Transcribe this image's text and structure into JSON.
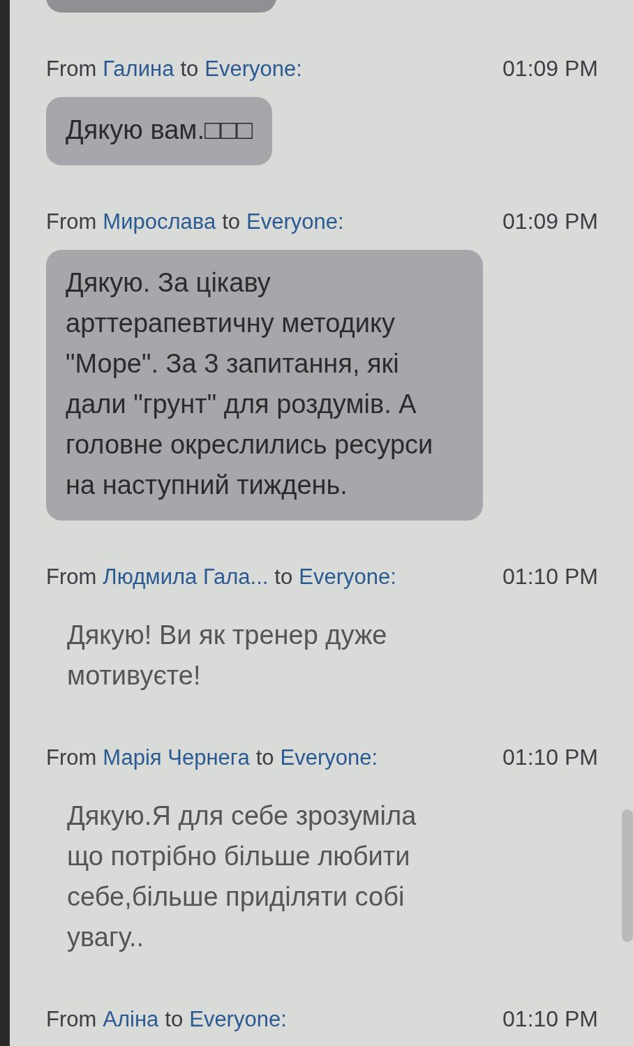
{
  "messages": [
    {
      "from_label": "From",
      "sender": "Галина",
      "to_label": "to",
      "recipient": "Everyone:",
      "time": "01:09 PM",
      "text": "Дякую вам.□□□",
      "bubble": true
    },
    {
      "from_label": "From",
      "sender": "Мирослава",
      "to_label": "to",
      "recipient": "Everyone:",
      "time": "01:09 PM",
      "text": "Дякую. За цікаву арттерапевтичну методику \"Море\". За 3 запитання, які дали \"грунт\" для роздумів. А головне окреслились ресурси на наступний тиждень.",
      "bubble": true
    },
    {
      "from_label": "From",
      "sender": "Людмила Гала...",
      "to_label": "to",
      "recipient": "Everyone:",
      "time": "01:10 PM",
      "text": "Дякую! Ви як тренер дуже мотивуєте!",
      "bubble": false
    },
    {
      "from_label": "From",
      "sender": "Марія Чернега",
      "to_label": "to",
      "recipient": "Everyone:",
      "time": "01:10 PM",
      "text": "Дякую.Я для себе зрозуміла що потрібно більше любити себе,більше приділяти собі увагу..",
      "bubble": false
    },
    {
      "from_label": "From",
      "sender": "Аліна",
      "to_label": "to",
      "recipient": "Everyone:",
      "time": "01:10 PM"
    }
  ]
}
